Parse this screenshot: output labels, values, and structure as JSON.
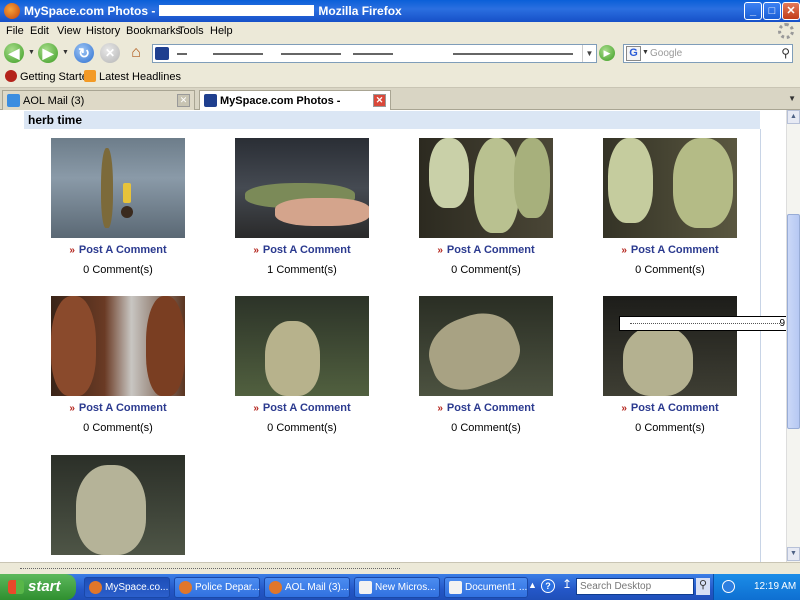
{
  "window": {
    "title_left": "MySpace.com Photos -",
    "title_right": "Mozilla Firefox",
    "minimize": "_",
    "maximize": "□",
    "close": "✕"
  },
  "menu": [
    "File",
    "Edit",
    "View",
    "History",
    "Bookmarks",
    "Tools",
    "Help"
  ],
  "nav": {
    "search_placeholder": "Google",
    "search_engine_letter": "G"
  },
  "bookmarks": [
    "Getting Started",
    "Latest Headlines"
  ],
  "tabs": [
    {
      "label": "AOL Mail (3)",
      "active": false
    },
    {
      "label": "MySpace.com Photos -",
      "active": true
    }
  ],
  "album": {
    "title": "herb time",
    "post_label": "Post A Comment",
    "photos": [
      {
        "comments": "0 Comment(s)"
      },
      {
        "comments": "1 Comment(s)"
      },
      {
        "comments": "0 Comment(s)"
      },
      {
        "comments": "0 Comment(s)"
      },
      {
        "comments": "0 Comment(s)"
      },
      {
        "comments": "0 Comment(s)"
      },
      {
        "comments": "0 Comment(s)"
      },
      {
        "comments": "0 Comment(s)"
      },
      {
        "comments": ""
      }
    ]
  },
  "tooltip": {
    "number": "9"
  },
  "taskbar": {
    "start": "start",
    "tasks": [
      "MySpace.co...",
      "Police Depar...",
      "AOL Mail (3)...",
      "New Micros...",
      "Document1 ..."
    ],
    "desktop_search": "Search Desktop",
    "clock": "12:19 AM"
  }
}
